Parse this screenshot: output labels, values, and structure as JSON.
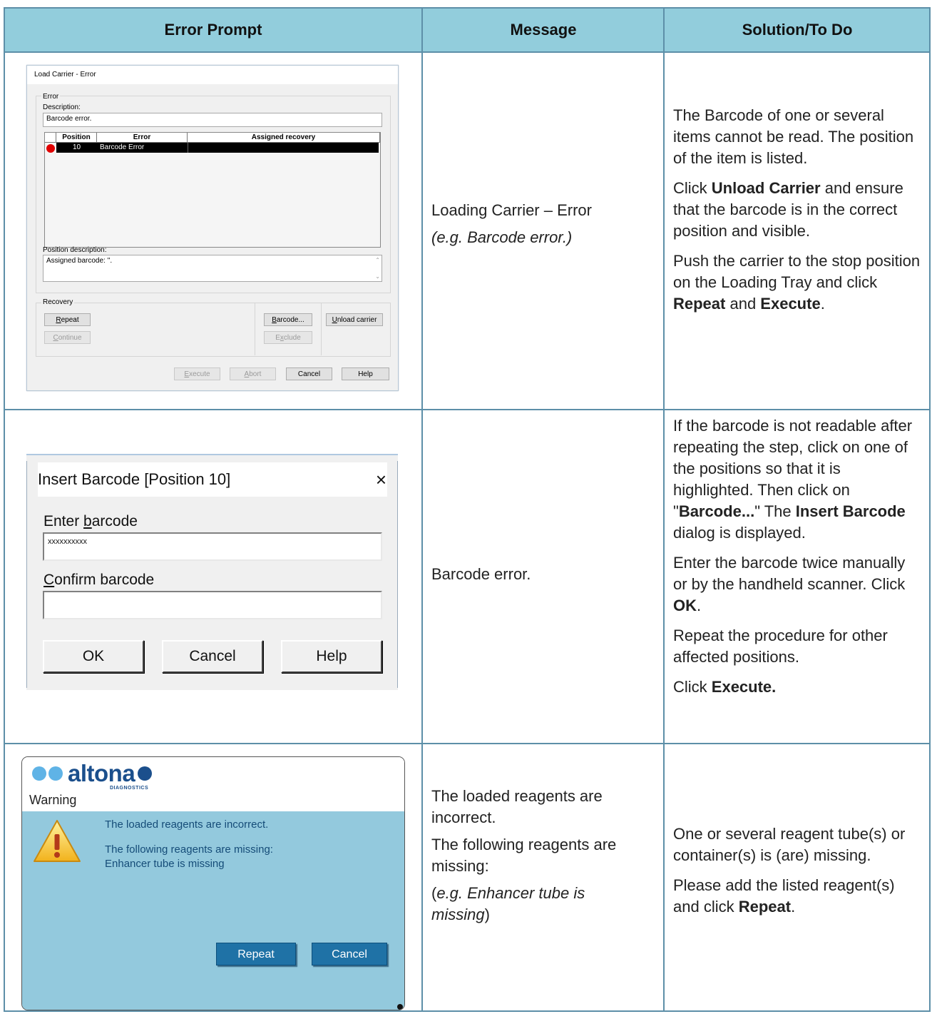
{
  "table": {
    "headers": [
      "Error Prompt",
      "Message",
      "Solution/To Do"
    ],
    "rows": [
      {
        "message": [
          "Loading Carrier – Error",
          "(e.g. Barcode error.)"
        ],
        "solution": [
          [
            {
              "t": "The Barcode of one or several items cannot be read. The position of the item is listed."
            }
          ],
          [
            {
              "t": "Click "
            },
            {
              "t": "Unload Carrier",
              "b": true
            },
            {
              "t": " and ensure that the barcode is in the correct position and visible."
            }
          ],
          [
            {
              "t": "Push the carrier to the stop position on the Loading Tray and click "
            },
            {
              "t": "Repeat",
              "b": true
            },
            {
              "t": " and "
            },
            {
              "t": "Execute",
              "b": true
            },
            {
              "t": "."
            }
          ]
        ]
      },
      {
        "message": [
          "Barcode error."
        ],
        "solution": [
          [
            {
              "t": "If the barcode is not readable after repeating the step, click on one of the positions so that it is highlighted. Then click on \""
            },
            {
              "t": "Barcode...",
              "b": true
            },
            {
              "t": "\" The "
            },
            {
              "t": "Insert Barcode",
              "b": true
            },
            {
              "t": " dialog is displayed."
            }
          ],
          [
            {
              "t": "Enter the barcode twice manually or by the handheld scanner. Click "
            },
            {
              "t": "OK",
              "b": true
            },
            {
              "t": "."
            }
          ],
          [
            {
              "t": "Repeat the procedure for other affected positions."
            }
          ],
          [
            {
              "t": "Click "
            },
            {
              "t": "Execute.",
              "b": true
            }
          ]
        ]
      },
      {
        "message": [
          "The loaded reagents are incorrect.",
          "The following reagents are missing:",
          "(e.g. Enhancer tube is missing)"
        ],
        "solution": [
          [
            {
              "t": "One or several reagent tube(s) or container(s) is (are) missing."
            }
          ],
          [
            {
              "t": "Please add the listed reagent(s) and click "
            },
            {
              "t": "Repeat",
              "b": true
            },
            {
              "t": "."
            }
          ]
        ]
      }
    ]
  },
  "dialog1": {
    "title": "Load Carrier - Error",
    "error_group": "Error",
    "description_label": "Description:",
    "description_value": "Barcode error.",
    "columns": [
      "Position",
      "Error",
      "Assigned recovery"
    ],
    "row": {
      "position": "10",
      "error": "Barcode Error",
      "recovery": ""
    },
    "position_description_label": "Position description:",
    "position_description_value": "Assigned barcode: ''.",
    "recovery_group": "Recovery",
    "buttons": {
      "repeat": "Repeat",
      "continue": "Continue",
      "barcode": "Barcode...",
      "exclude": "Exclude",
      "unload": "Unload carrier",
      "execute": "Execute",
      "abort": "Abort",
      "cancel": "Cancel",
      "help": "Help"
    }
  },
  "dialog2": {
    "title": "Insert Barcode [Position 10]",
    "close": "×",
    "enter_label": "Enter barcode",
    "enter_value": "xxxxxxxxxx",
    "confirm_label": "Confirm barcode",
    "confirm_value": "",
    "ok": "OK",
    "cancel": "Cancel",
    "help": "Help"
  },
  "dialog3": {
    "brand": "altona",
    "brand_sub": "DIAGNOSTICS",
    "title": "Warning",
    "line1": "The loaded reagents are incorrect.",
    "line2": "The following reagents are missing:",
    "line3": "Enhancer tube is missing",
    "repeat": "Repeat",
    "cancel": "Cancel",
    "colors": {
      "light_dot": "#5fb3e6",
      "dark_dot": "#1b4f8c",
      "body": "#93c9dd",
      "button": "#1f72a6"
    }
  },
  "colors": {
    "header_bg": "#92cddc",
    "border": "#5d8fa8"
  }
}
